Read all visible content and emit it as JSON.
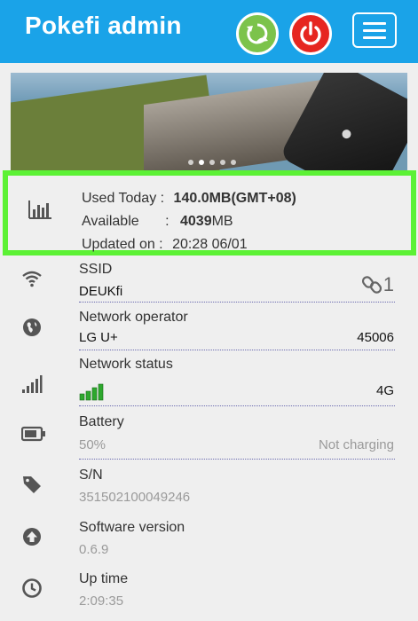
{
  "header": {
    "title": "Pokefi admin"
  },
  "usage": {
    "used_today_label": "Used Today :",
    "used_today_value": "140.0MB(GMT+08)",
    "available_label": "Available",
    "available_colon": ":",
    "available_value": "4039",
    "available_unit": "MB",
    "updated_label": "Updated on :",
    "updated_value": "20:28 06/01"
  },
  "ssid": {
    "title": "SSID",
    "value": "DEUKfi",
    "clients": "1"
  },
  "operator": {
    "title": "Network operator",
    "value": "LG U+",
    "code": "45006"
  },
  "network": {
    "title": "Network status",
    "type": "4G",
    "signal_bars": 4
  },
  "battery": {
    "title": "Battery",
    "value": "50%",
    "state": "Not charging"
  },
  "serial": {
    "title": "S/N",
    "value": "351502100049246"
  },
  "software": {
    "title": "Software version",
    "value": "0.6.9"
  },
  "uptime": {
    "title": "Up time",
    "value": "2:09:35"
  },
  "colors": {
    "header": "#1aa3e8",
    "refresh": "#7cc34b",
    "power": "#e62620",
    "highlight": "#5cf135",
    "signal": "#2ea82e"
  }
}
